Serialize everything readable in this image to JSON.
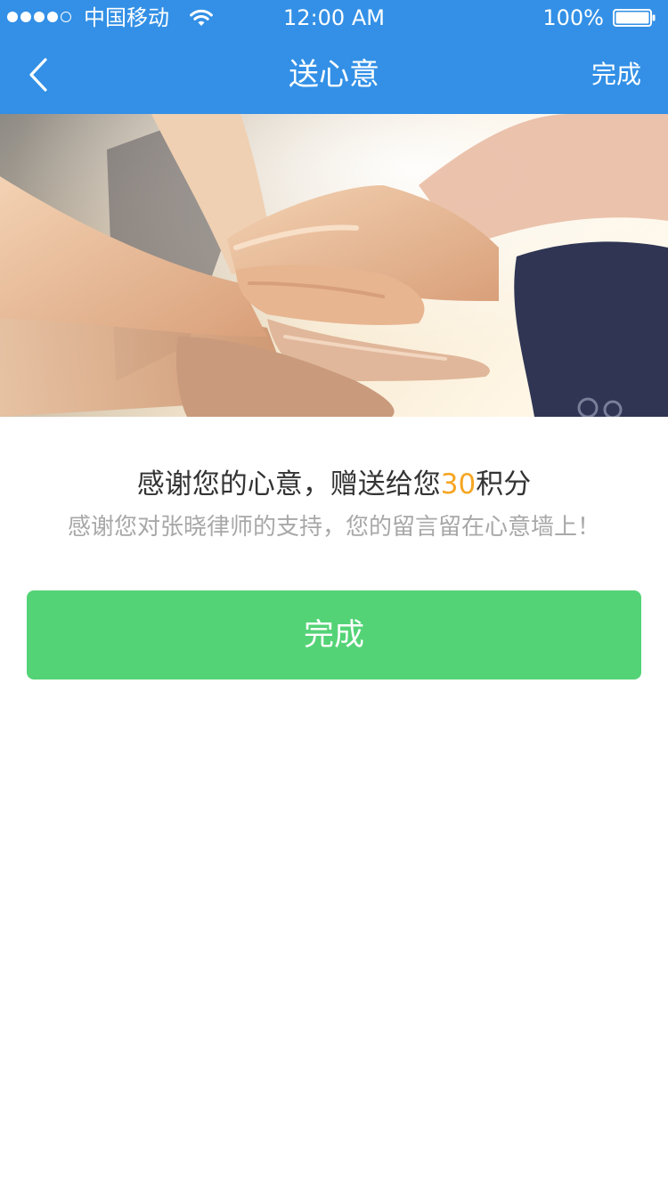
{
  "status_bar": {
    "signal_filled": 4,
    "signal_total": 5,
    "carrier": "中国移动",
    "time": "12:00 AM",
    "battery_percent": "100%",
    "battery_level": 1.0
  },
  "nav": {
    "back_icon": "chevron-left-icon",
    "title": "送心意",
    "done_label": "完成"
  },
  "hero": {
    "image_subject": "hands-stacked-together"
  },
  "message": {
    "title_prefix": "感谢您的心意，赠送给您",
    "points_value": "30",
    "title_suffix": "积分",
    "subtitle": "感谢您对张晓律师的支持，您的留言留在心意墙上！"
  },
  "actions": {
    "done_button_label": "完成"
  },
  "colors": {
    "header_bg": "#3390e6",
    "accent_points": "#f5a623",
    "button_green": "#54d376",
    "title_text": "#333333",
    "subtitle_text": "#a8a8a8"
  }
}
